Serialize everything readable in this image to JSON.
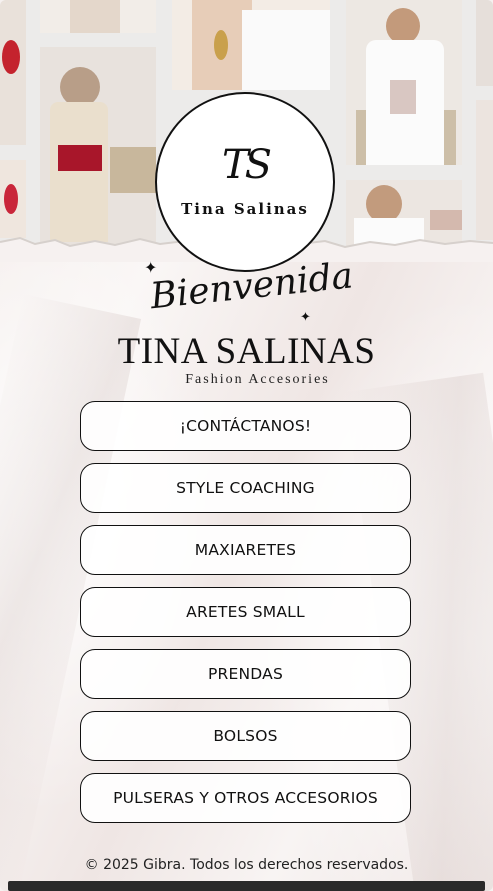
{
  "logo": {
    "monogram": "TS",
    "name": "Tina Salinas"
  },
  "hero": {
    "welcome": "Bienvenida",
    "brand": "TINA SALINAS",
    "tagline": "Fashion Accesories"
  },
  "links": [
    {
      "label": "¡CONTÁCTANOS!"
    },
    {
      "label": "STYLE COACHING"
    },
    {
      "label": "MAXIARETES"
    },
    {
      "label": "ARETES SMALL"
    },
    {
      "label": "PRENDAS"
    },
    {
      "label": "BOLSOS"
    },
    {
      "label": "PULSERAS Y OTROS ACCESORIOS"
    }
  ],
  "footer": {
    "copyright": "© 2025 Gibra. Todos los derechos reservados."
  },
  "colors": {
    "text": "#111111",
    "background": "#f6f1f0",
    "accent_red": "#b0182a"
  }
}
